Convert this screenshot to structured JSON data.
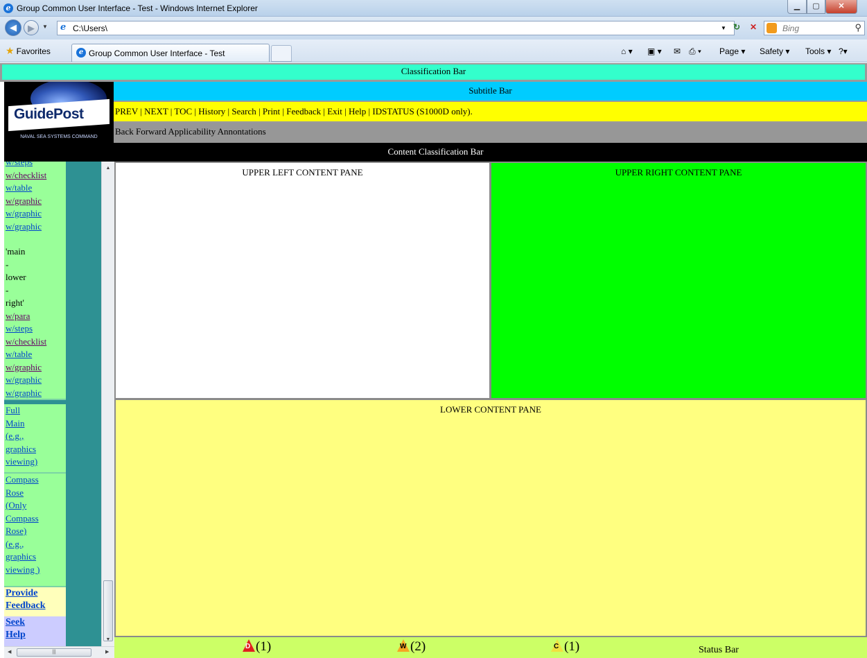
{
  "browser": {
    "window_title": "Group Common User Interface - Test - Windows Internet Explorer",
    "url": "C:\\Users\\",
    "search_placeholder": "Bing",
    "favorites_label": "Favorites",
    "tab_title": "Group Common User Interface - Test",
    "commands": {
      "page": "Page ▾",
      "safety": "Safety ▾",
      "tools": "Tools ▾"
    }
  },
  "page": {
    "classification_bar": "Classification Bar",
    "subtitle_bar": "Subtitle Bar",
    "logo": {
      "name": "GuidePost",
      "subtitle": "NAVAL SEA SYSTEMS COMMAND"
    },
    "nav_links": [
      "PREV",
      "NEXT",
      "TOC",
      "History",
      "Search",
      "Print",
      "Feedback",
      "Exit",
      "Help",
      "IDSTATUS (S1000D only)."
    ],
    "secondary_toolbar": "Back Forward Applicability Annontations",
    "content_classification_bar": "Content Classification Bar",
    "panes": {
      "upper_left": "UPPER LEFT CONTENT PANE",
      "upper_right": "UPPER RIGHT CONTENT PANE",
      "lower": "LOWER CONTENT PANE"
    },
    "left_frame": {
      "block1": [
        "w/steps",
        "w/checklist",
        "w/table",
        "w/graphic",
        "w/graphic",
        "w/graphic"
      ],
      "main_label": [
        "'main",
        "-",
        "lower",
        "-",
        "right'"
      ],
      "block2": [
        "w/para",
        "w/steps",
        "w/checklist",
        "w/table",
        "w/graphic",
        "w/graphic",
        "w/graphic"
      ],
      "full_main": [
        "Full",
        "Main",
        "(e.g.,",
        "graphics",
        "viewing)"
      ],
      "compass": [
        "Compass",
        "Rose",
        "(Only",
        "Compass",
        "Rose)",
        "(e.g.,",
        "graphics",
        "viewing )"
      ],
      "feedback": [
        "Provide",
        "Feedback"
      ],
      "help": [
        "Seek",
        "Help"
      ]
    },
    "status_bar": {
      "items": [
        {
          "letter": "D",
          "count": "(1)",
          "color": "#e02020"
        },
        {
          "letter": "W",
          "count": "(2)",
          "color": "#f5a623"
        },
        {
          "letter": "C",
          "count": "(1)",
          "color": "#f0e040"
        }
      ],
      "label": "Status Bar"
    }
  }
}
